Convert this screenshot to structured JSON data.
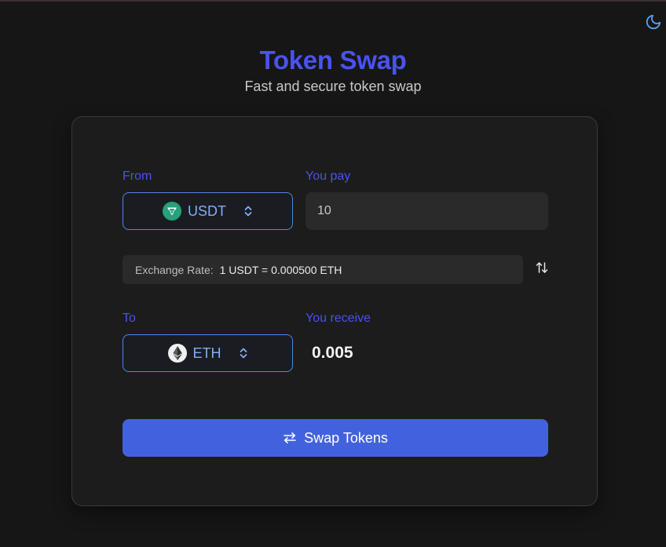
{
  "header": {
    "title": "Token Swap",
    "subtitle": "Fast and secure token swap"
  },
  "theme_toggle": {
    "icon": "moon-icon"
  },
  "from": {
    "label": "From",
    "token": "USDT",
    "token_icon": "usdt-icon",
    "token_color": "#26a17b"
  },
  "pay": {
    "label": "You pay",
    "value": "10"
  },
  "exchange_rate": {
    "label": "Exchange Rate:",
    "value": "1 USDT = 0.000500 ETH"
  },
  "swap_direction": {
    "icon": "swap-vertical-icon"
  },
  "to": {
    "label": "To",
    "token": "ETH",
    "token_icon": "eth-icon"
  },
  "receive": {
    "label": "You receive",
    "value": "0.005"
  },
  "swap_button": {
    "label": "Swap Tokens",
    "icon": "swap-horizontal-icon"
  },
  "colors": {
    "accent": "#4a52f0",
    "button": "#4262dd",
    "select_border": "#4f86e8",
    "background": "#161616",
    "card": "#1c1c1c"
  }
}
